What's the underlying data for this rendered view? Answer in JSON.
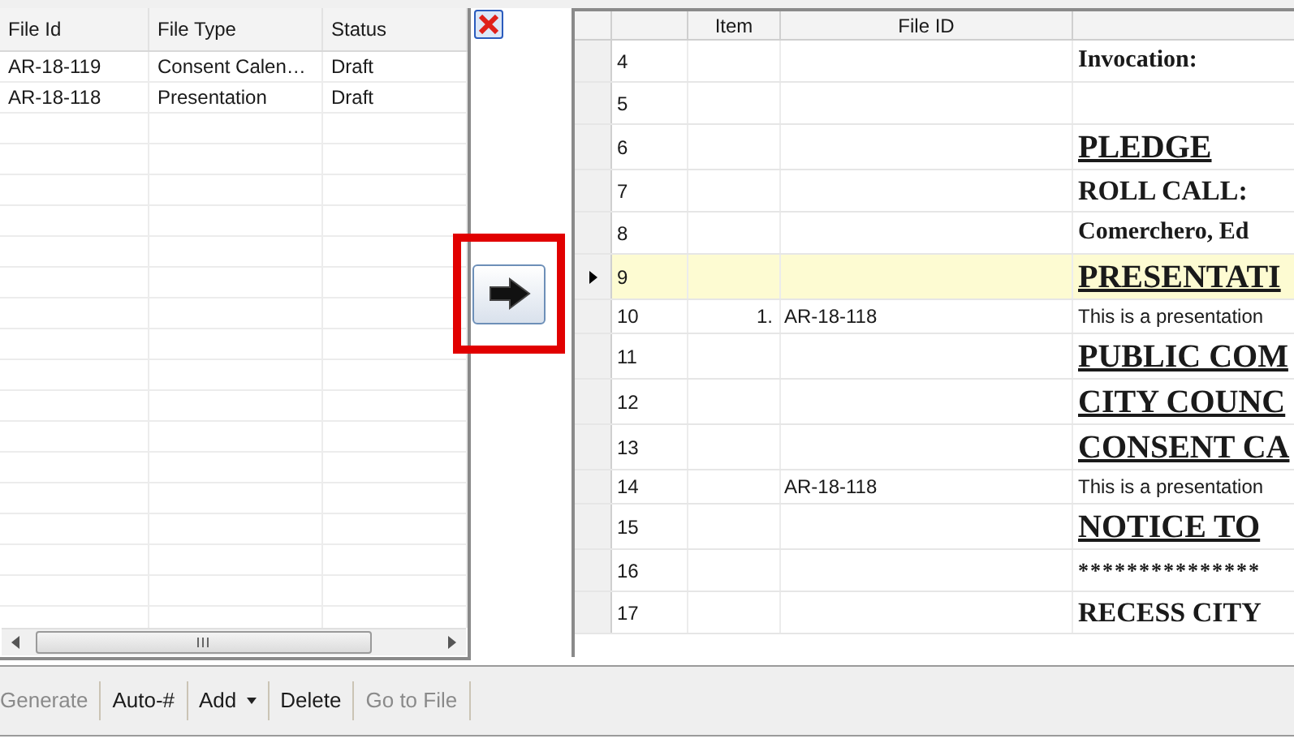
{
  "files_grid": {
    "columns": [
      "File Id",
      "File Type",
      "Status"
    ],
    "rows": [
      {
        "file_id": "AR-18-119",
        "file_type": "Consent Calen…",
        "status": "Draft"
      },
      {
        "file_id": "AR-18-118",
        "file_type": "Presentation",
        "status": "Draft"
      }
    ]
  },
  "close_button": {
    "kind": "close"
  },
  "move_button": {
    "highlighted": true
  },
  "agenda_grid": {
    "columns": [
      "Item",
      "File ID"
    ],
    "rows": [
      {
        "number": "4",
        "kind": "label",
        "text": "Invocation:",
        "selected": false
      },
      {
        "number": "5",
        "kind": "blank",
        "selected": false
      },
      {
        "number": "6",
        "kind": "heading",
        "text": "PLEDGE",
        "selected": false
      },
      {
        "number": "7",
        "kind": "subheading",
        "text": "ROLL CALL:",
        "selected": false
      },
      {
        "number": "8",
        "kind": "label",
        "text": "Comerchero, Ed",
        "selected": false
      },
      {
        "number": "9",
        "kind": "heading",
        "text": "PRESENTATI",
        "selected": true
      },
      {
        "number": "10",
        "kind": "note",
        "item": "1.",
        "file_id": "AR-18-118",
        "text": "This is a presentation",
        "selected": false
      },
      {
        "number": "11",
        "kind": "heading",
        "text": "PUBLIC COM",
        "selected": false
      },
      {
        "number": "12",
        "kind": "heading",
        "text": "CITY COUNC",
        "selected": false
      },
      {
        "number": "13",
        "kind": "heading",
        "text": "CONSENT CA",
        "selected": false
      },
      {
        "number": "14",
        "kind": "note",
        "file_id": "AR-18-118",
        "text": "This is a presentation",
        "selected": false
      },
      {
        "number": "15",
        "kind": "heading",
        "text": "NOTICE TO",
        "selected": false
      },
      {
        "number": "16",
        "kind": "stars",
        "text": "***************",
        "selected": false
      },
      {
        "number": "17",
        "kind": "subheading",
        "text": "RECESS CITY",
        "selected": false
      }
    ]
  },
  "toolbar": [
    {
      "label": "Generate",
      "disabled": true
    },
    {
      "label": "Auto-#",
      "disabled": false
    },
    {
      "label": "Add",
      "disabled": false,
      "dropdown": true
    },
    {
      "label": "Delete",
      "disabled": false
    },
    {
      "label": "Go to File",
      "disabled": true
    }
  ]
}
